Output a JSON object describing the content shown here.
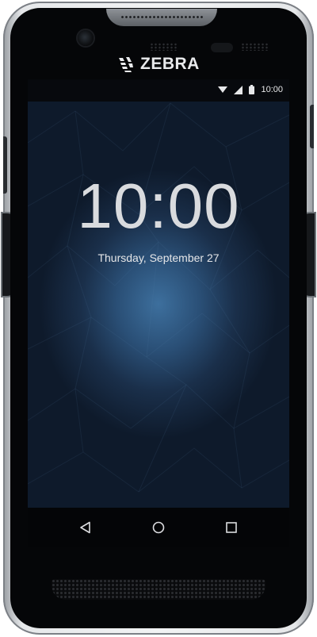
{
  "brand": {
    "name": "ZEBRA"
  },
  "status_bar": {
    "time": "10:00",
    "icons": [
      "wifi-icon",
      "cellular-signal-icon",
      "battery-icon"
    ]
  },
  "lock_screen": {
    "clock": "10:00",
    "date": "Thursday, September 27"
  },
  "nav_bar": {
    "buttons": [
      "back",
      "home",
      "recents"
    ]
  }
}
